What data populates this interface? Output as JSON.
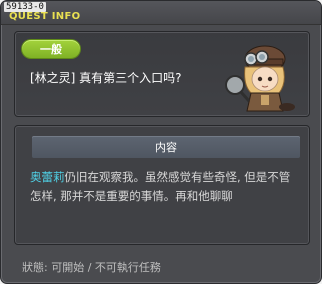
{
  "window": {
    "id_label": "59133-0",
    "title": "QUEST INFO"
  },
  "quest": {
    "category": "一般",
    "title": "[林之灵] 真有第三个入口吗?"
  },
  "section": {
    "header": "内容",
    "npc_name": "奥蕾莉",
    "description": "仍旧在观察我。虽然感觉有些奇怪, 但是不管怎样, 那并不是重要的事情。再和他聊聊"
  },
  "status": {
    "text": "狀態:  可開始 / 不可執行任務"
  },
  "colors": {
    "title": "#e9e052",
    "npc_highlight": "#4fd1e6",
    "category_pill": "#8bc130"
  }
}
